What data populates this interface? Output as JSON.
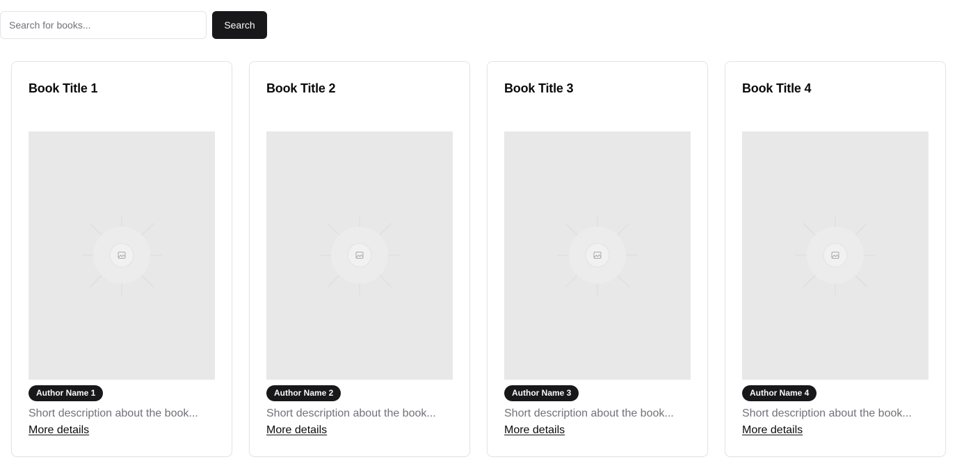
{
  "search": {
    "placeholder": "Search for books...",
    "value": "",
    "button_label": "Search"
  },
  "books": [
    {
      "title": "Book Title 1",
      "author": "Author Name 1",
      "description": "Short description about the book...",
      "link_label": "More details",
      "cover_icon": "image-placeholder-icon"
    },
    {
      "title": "Book Title 2",
      "author": "Author Name 2",
      "description": "Short description about the book...",
      "link_label": "More details",
      "cover_icon": "image-placeholder-icon"
    },
    {
      "title": "Book Title 3",
      "author": "Author Name 3",
      "description": "Short description about the book...",
      "link_label": "More details",
      "cover_icon": "image-placeholder-icon"
    },
    {
      "title": "Book Title 4",
      "author": "Author Name 4",
      "description": "Short description about the book...",
      "link_label": "More details",
      "cover_icon": "image-placeholder-icon"
    }
  ],
  "colors": {
    "primary": "#18181b",
    "muted_text": "#71717a",
    "border": "#e4e4e7",
    "cover_placeholder": "#e8e8e8"
  }
}
